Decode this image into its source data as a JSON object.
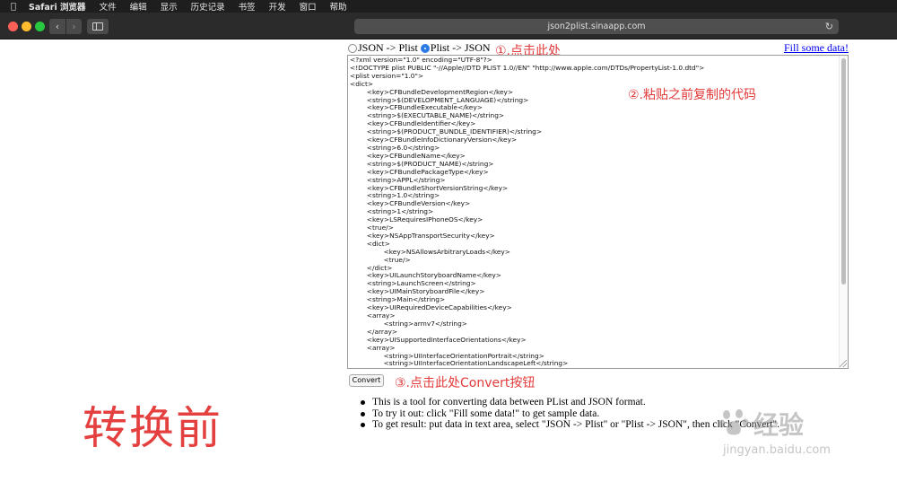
{
  "menubar": {
    "items": [
      "Safari 浏览器",
      "文件",
      "编辑",
      "显示",
      "历史记录",
      "书签",
      "开发",
      "窗口",
      "帮助"
    ]
  },
  "toolbar": {
    "address": "json2plist.sinaapp.com",
    "back_glyph": "‹",
    "forward_glyph": "›",
    "reload_glyph": "↻"
  },
  "page": {
    "radio_json_to_plist": "JSON -> Plist",
    "radio_plist_to_json": "Plist -> JSON",
    "selected_mode": "Plist -> JSON",
    "fill_link": "Fill some data!",
    "textarea_value": "<?xml version=\"1.0\" encoding=\"UTF-8\"?>\n<!DOCTYPE plist PUBLIC \"-//Apple//DTD PLIST 1.0//EN\" \"http://www.apple.com/DTDs/PropertyList-1.0.dtd\">\n<plist version=\"1.0\">\n<dict>\n\t<key>CFBundleDevelopmentRegion</key>\n\t<string>$(DEVELOPMENT_LANGUAGE)</string>\n\t<key>CFBundleExecutable</key>\n\t<string>$(EXECUTABLE_NAME)</string>\n\t<key>CFBundleIdentifier</key>\n\t<string>$(PRODUCT_BUNDLE_IDENTIFIER)</string>\n\t<key>CFBundleInfoDictionaryVersion</key>\n\t<string>6.0</string>\n\t<key>CFBundleName</key>\n\t<string>$(PRODUCT_NAME)</string>\n\t<key>CFBundlePackageType</key>\n\t<string>APPL</string>\n\t<key>CFBundleShortVersionString</key>\n\t<string>1.0</string>\n\t<key>CFBundleVersion</key>\n\t<string>1</string>\n\t<key>LSRequiresIPhoneOS</key>\n\t<true/>\n\t<key>NSAppTransportSecurity</key>\n\t<dict>\n\t\t<key>NSAllowsArbitraryLoads</key>\n\t\t<true/>\n\t</dict>\n\t<key>UILaunchStoryboardName</key>\n\t<string>LaunchScreen</string>\n\t<key>UIMainStoryboardFile</key>\n\t<string>Main</string>\n\t<key>UIRequiredDeviceCapabilities</key>\n\t<array>\n\t\t<string>armv7</string>\n\t</array>\n\t<key>UISupportedInterfaceOrientations</key>\n\t<array>\n\t\t<string>UIInterfaceOrientationPortrait</string>\n\t\t<string>UIInterfaceOrientationLandscapeLeft</string>",
    "convert_button": "Convert",
    "info_items": [
      "This is a tool for converting data between PList and JSON format.",
      "To try it out: click \"Fill some data!\" to get sample data.",
      "To get result: put data in text area, select \"JSON -> Plist\" or \"Plist -> JSON\", then click \"Convert\"."
    ]
  },
  "annotations": {
    "step1": "①.点击此处",
    "step2": "②.粘贴之前复制的代码",
    "step3": "③.点击此处Convert按钮",
    "before_label": "转换前",
    "color": "#e23a3a"
  },
  "watermark": {
    "title": "经验",
    "url": "jingyan.baidu.com"
  },
  "colors": {
    "traffic_red": "#fe5f57",
    "traffic_yellow": "#febc2e",
    "traffic_green": "#28c840",
    "link": "#0000ee",
    "radio_selected": "#2d7be5"
  }
}
